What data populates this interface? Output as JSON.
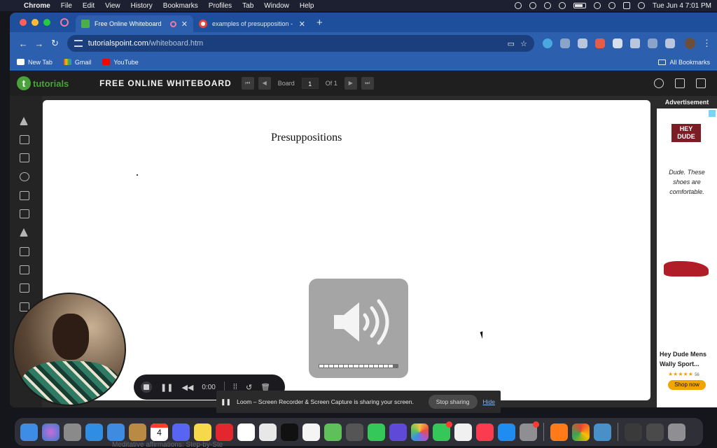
{
  "menubar": {
    "app": "Chrome",
    "items": [
      "File",
      "Edit",
      "View",
      "History",
      "Bookmarks",
      "Profiles",
      "Tab",
      "Window",
      "Help"
    ],
    "clock": "Tue Jun 4  7:01 PM"
  },
  "tabs": [
    {
      "title": "Free Online Whiteboard",
      "active": true
    },
    {
      "title": "examples of presupposition -",
      "active": false
    }
  ],
  "address": {
    "host": "tutorialspoint.com",
    "path": "/whiteboard.htm"
  },
  "bookmarks": {
    "items": [
      "New Tab",
      "Gmail",
      "YouTube"
    ],
    "all": "All Bookmarks"
  },
  "app": {
    "logo_mark": "t",
    "logo_text": "tutorials",
    "logo_text_suffix": "point",
    "title": "FREE ONLINE WHITEBOARD",
    "board_label": "Board",
    "board_value": "1",
    "board_of": "Of 1"
  },
  "canvas": {
    "title": "Presuppositions"
  },
  "ad": {
    "header": "Advertisement",
    "brand": "HEY DUDE",
    "tagline": "Dude. These shoes are comfortable.",
    "product": "Hey Dude Mens Wally Sport...",
    "rating_count": "56",
    "cta": "Shop now"
  },
  "loom": {
    "time": "0:00",
    "share_message": "Loom – Screen Recorder & Screen Capture is sharing your screen.",
    "stop_label": "Stop sharing",
    "hide_label": "Hide"
  },
  "volume": {
    "level": 0.95
  },
  "dock": {
    "calendar_day": "4",
    "under_text": "Meditative affirmations: Step-by-Ste"
  }
}
